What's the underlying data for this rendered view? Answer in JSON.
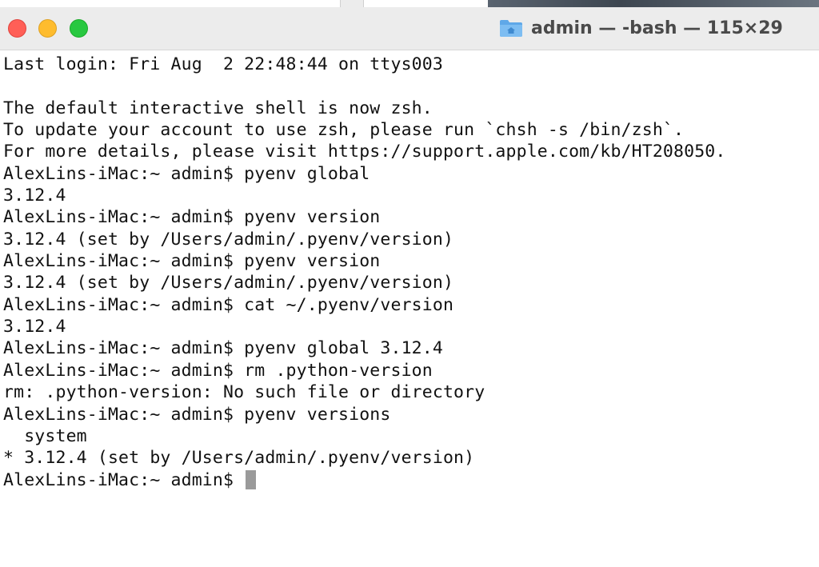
{
  "window": {
    "title": "admin — -bash — 115×29",
    "title_icon": "home-folder-icon"
  },
  "traffic_lights": {
    "close_color": "#ff5f57",
    "minimize_color": "#febc2e",
    "zoom_color": "#28c840"
  },
  "terminal": {
    "lines": [
      "Last login: Fri Aug  2 22:48:44 on ttys003",
      "",
      "The default interactive shell is now zsh.",
      "To update your account to use zsh, please run `chsh -s /bin/zsh`.",
      "For more details, please visit https://support.apple.com/kb/HT208050.",
      "AlexLins-iMac:~ admin$ pyenv global",
      "3.12.4",
      "AlexLins-iMac:~ admin$ pyenv version",
      "3.12.4 (set by /Users/admin/.pyenv/version)",
      "AlexLins-iMac:~ admin$ pyenv version",
      "3.12.4 (set by /Users/admin/.pyenv/version)",
      "AlexLins-iMac:~ admin$ cat ~/.pyenv/version",
      "3.12.4",
      "AlexLins-iMac:~ admin$ pyenv global 3.12.4",
      "AlexLins-iMac:~ admin$ rm .python-version",
      "rm: .python-version: No such file or directory",
      "AlexLins-iMac:~ admin$ pyenv versions",
      "  system",
      "* 3.12.4 (set by /Users/admin/.pyenv/version)"
    ],
    "prompt": "AlexLins-iMac:~ admin$ "
  }
}
